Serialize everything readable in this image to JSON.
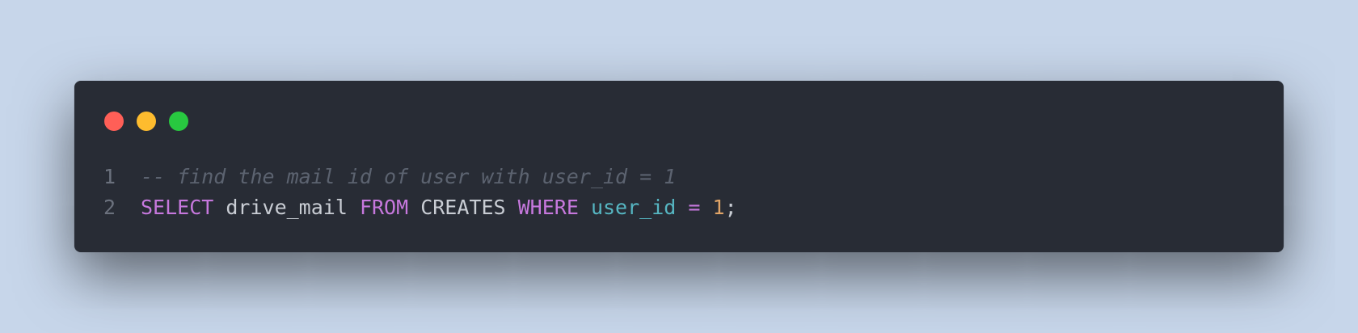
{
  "window": {
    "controls": [
      {
        "name": "close",
        "color": "#ff5f57"
      },
      {
        "name": "minimize",
        "color": "#febc2e"
      },
      {
        "name": "maximize",
        "color": "#28c840"
      }
    ]
  },
  "code": {
    "lines": [
      {
        "number": "1",
        "tokens": [
          {
            "type": "comment",
            "text": "-- find the mail id of user with user_id = 1"
          }
        ]
      },
      {
        "number": "2",
        "tokens": [
          {
            "type": "kw",
            "text": "SELECT"
          },
          {
            "type": "plain",
            "text": " drive_mail "
          },
          {
            "type": "kw",
            "text": "FROM"
          },
          {
            "type": "plain",
            "text": " CREATES "
          },
          {
            "type": "kw",
            "text": "WHERE"
          },
          {
            "type": "plain",
            "text": " "
          },
          {
            "type": "ident",
            "text": "user_id"
          },
          {
            "type": "plain",
            "text": " "
          },
          {
            "type": "op",
            "text": "="
          },
          {
            "type": "plain",
            "text": " "
          },
          {
            "type": "num",
            "text": "1"
          },
          {
            "type": "plain",
            "text": ";"
          }
        ]
      }
    ]
  }
}
